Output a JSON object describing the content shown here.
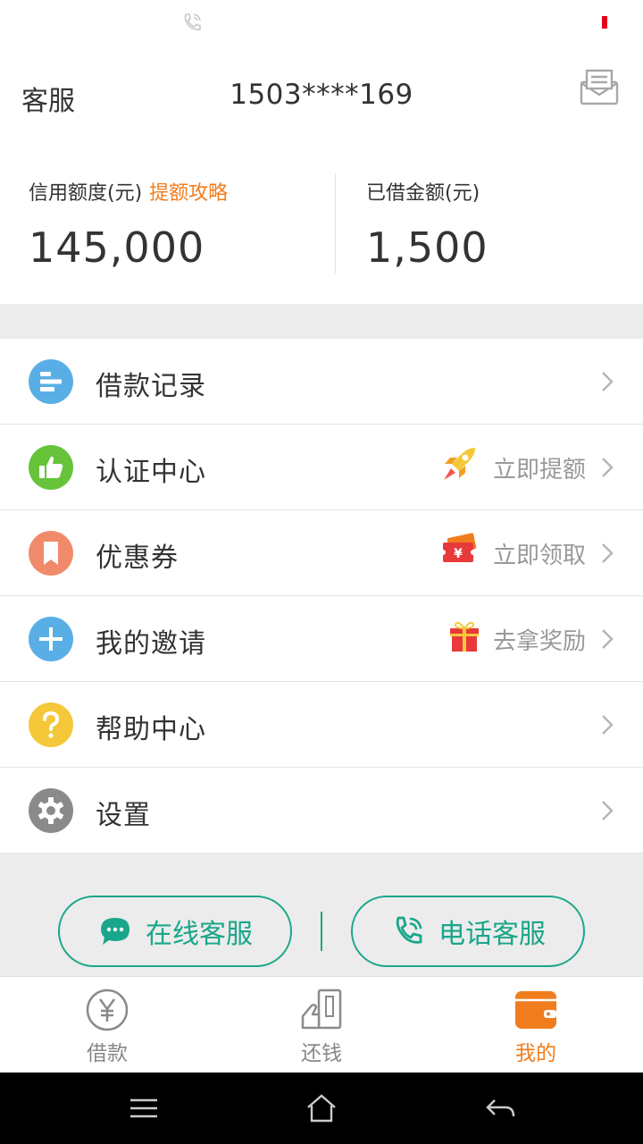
{
  "header": {
    "service_label": "客服",
    "phone_masked": "1503****169"
  },
  "credit": {
    "limit_label": "信用额度(元)",
    "limit_link": "提额攻略",
    "limit_value": "145,000",
    "borrowed_label": "已借金额(元)",
    "borrowed_value": "1,500"
  },
  "menu": {
    "items": [
      {
        "label": "借款记录",
        "icon": "list-icon",
        "color": "#5aaee6",
        "extra": ""
      },
      {
        "label": "认证中心",
        "icon": "thumbs-up-icon",
        "color": "#66c33a",
        "extra": "立即提额"
      },
      {
        "label": "优惠券",
        "icon": "bookmark-icon",
        "color": "#f08a6a",
        "extra": "立即领取"
      },
      {
        "label": "我的邀请",
        "icon": "plus-icon",
        "color": "#5aaee6",
        "extra": "去拿奖励"
      },
      {
        "label": "帮助中心",
        "icon": "question-icon",
        "color": "#f5c83a",
        "extra": ""
      },
      {
        "label": "设置",
        "icon": "gear-icon",
        "color": "#8a8a8a",
        "extra": ""
      }
    ]
  },
  "contact": {
    "online_label": "在线客服",
    "phone_label": "电话客服"
  },
  "tabs": [
    {
      "label": "借款",
      "icon": "yen-coin-icon"
    },
    {
      "label": "还钱",
      "icon": "repay-icon"
    },
    {
      "label": "我的",
      "icon": "wallet-icon",
      "active": true
    }
  ],
  "colors": {
    "accent_orange": "#f07d1d",
    "accent_green": "#1aa68a"
  }
}
